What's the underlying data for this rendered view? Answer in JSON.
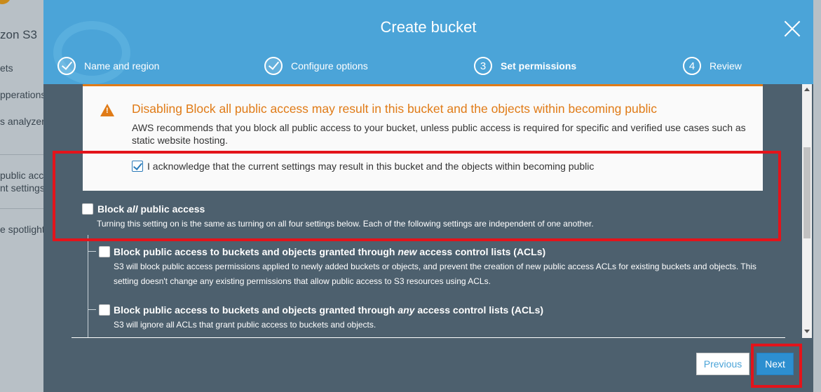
{
  "background": {
    "title": "zon S3",
    "items": [
      "ets",
      "pperations",
      "s analyzer",
      "public acce",
      "nt settings",
      "e spotlight"
    ]
  },
  "modal": {
    "title": "Create bucket",
    "steps": [
      {
        "number": "",
        "label": "Name and region",
        "state": "done"
      },
      {
        "number": "",
        "label": "Configure options",
        "state": "done"
      },
      {
        "number": "3",
        "label": "Set permissions",
        "state": "active"
      },
      {
        "number": "4",
        "label": "Review",
        "state": "pending"
      }
    ],
    "warning": {
      "title": "Disabling Block all public access may result in this bucket and the objects within becoming public",
      "text": "AWS recommends that you block all public access to your bucket, unless public access is required for specific and verified use cases such as static website hosting.",
      "acknowledge_label": "I acknowledge that the current settings may result in this bucket and the objects within becoming public",
      "acknowledge_checked": true
    },
    "block_all": {
      "label_prefix": "Block ",
      "label_emphasis": "all",
      "label_suffix": " public access",
      "description": "Turning this setting on is the same as turning on all four settings below. Each of the following settings are independent of one another.",
      "checked": false
    },
    "acl_settings": [
      {
        "label_prefix": "Block public access to buckets and objects granted through ",
        "label_emphasis": "new",
        "label_suffix": " access control lists (ACLs)",
        "description": "S3 will block public access permissions applied to newly added buckets or objects, and prevent the creation of new public access ACLs for existing buckets and objects. This setting doesn't change any existing permissions that allow public access to S3 resources using ACLs.",
        "checked": false
      },
      {
        "label_prefix": "Block public access to buckets and objects granted through ",
        "label_emphasis": "any",
        "label_suffix": " access control lists (ACLs)",
        "description": "S3 will ignore all ACLs that grant public access to buckets and objects.",
        "checked": false
      }
    ],
    "buttons": {
      "previous": "Previous",
      "next": "Next"
    }
  },
  "colors": {
    "header": "#4ba4d8",
    "modal_body": "#4d606e",
    "warning": "#e07b17",
    "highlight": "#e3141b",
    "primary_button": "#2d8fd0"
  }
}
